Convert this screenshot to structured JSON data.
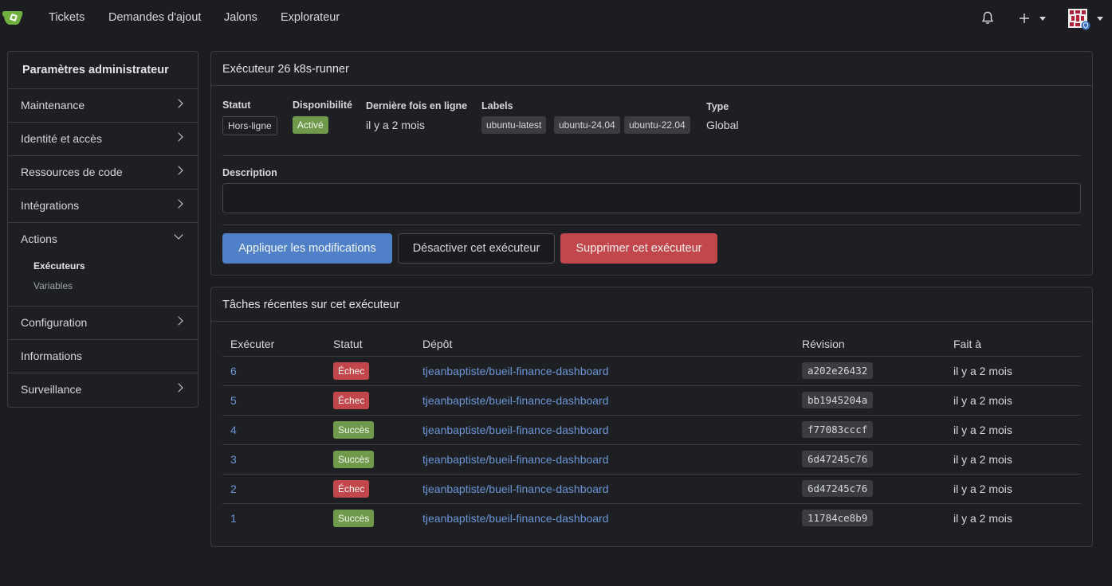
{
  "nav": {
    "items": [
      "Tickets",
      "Demandes d'ajout",
      "Jalons",
      "Explorateur"
    ]
  },
  "sidebar": {
    "title": "Paramètres administrateur",
    "items_top": [
      "Maintenance",
      "Identité et accès",
      "Ressources de code",
      "Intégrations"
    ],
    "actions_label": "Actions",
    "sub_items": [
      "Exécuteurs",
      "Variables"
    ],
    "items_bottom": [
      "Configuration",
      "Informations",
      "Surveillance"
    ]
  },
  "runner": {
    "title": "Exécuteur 26 k8s-runner",
    "status_label": "Statut",
    "status_value": "Hors-ligne",
    "availability_label": "Disponibilité",
    "availability_value": "Activé",
    "last_online_label": "Dernière fois en ligne",
    "last_online_value": "il y a 2 mois",
    "labels_label": "Labels",
    "labels": [
      "ubuntu-latest",
      "ubuntu-24.04",
      "ubuntu-22.04"
    ],
    "type_label": "Type",
    "type_value": "Global",
    "description_label": "Description",
    "description_value": "",
    "apply_button": "Appliquer les modifications",
    "disable_button": "Désactiver cet exécuteur",
    "delete_button": "Supprimer cet exécuteur"
  },
  "tasks": {
    "title": "Tâches récentes sur cet exécuteur",
    "columns": [
      "Exécuter",
      "Statut",
      "Dépôt",
      "Révision",
      "Fait à"
    ],
    "rows": [
      {
        "run": "6",
        "status": "Échec",
        "status_type": "fail",
        "repo": "tjeanbaptiste/bueil-finance-dashboard",
        "sha": "a202e26432",
        "done": "il y a 2 mois"
      },
      {
        "run": "5",
        "status": "Échec",
        "status_type": "fail",
        "repo": "tjeanbaptiste/bueil-finance-dashboard",
        "sha": "bb1945204a",
        "done": "il y a 2 mois"
      },
      {
        "run": "4",
        "status": "Succès",
        "status_type": "success",
        "repo": "tjeanbaptiste/bueil-finance-dashboard",
        "sha": "f77083cccf",
        "done": "il y a 2 mois"
      },
      {
        "run": "3",
        "status": "Succès",
        "status_type": "success",
        "repo": "tjeanbaptiste/bueil-finance-dashboard",
        "sha": "6d47245c76",
        "done": "il y a 2 mois"
      },
      {
        "run": "2",
        "status": "Échec",
        "status_type": "fail",
        "repo": "tjeanbaptiste/bueil-finance-dashboard",
        "sha": "6d47245c76",
        "done": "il y a 2 mois"
      },
      {
        "run": "1",
        "status": "Succès",
        "status_type": "success",
        "repo": "tjeanbaptiste/bueil-finance-dashboard",
        "sha": "11784ce8b9",
        "done": "il y a 2 mois"
      }
    ]
  },
  "colors": {
    "success": "#6f9a4c",
    "fail": "#c2474c",
    "primary": "#4f80c8",
    "link": "#6b95d6"
  }
}
